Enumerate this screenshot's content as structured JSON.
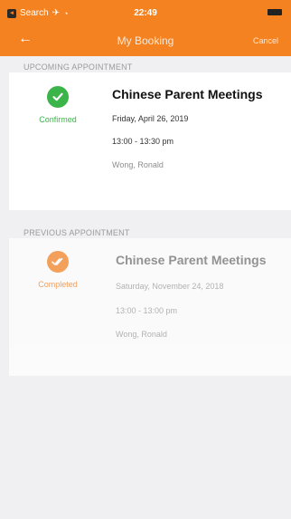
{
  "status_bar": {
    "carrier": "Search",
    "time": "22:49"
  },
  "nav": {
    "back_icon": "back-arrow-icon",
    "title": "My Booking",
    "cancel_label": "Cancel"
  },
  "upcoming": {
    "section_label": "UPCOMING APPOINTMENT",
    "status_label": "Confirmed",
    "status_color": "#3bb44a",
    "meeting_title": "Chinese Parent Meetings",
    "date": "Friday, April 26, 2019",
    "time": "13:00 - 13:30 pm",
    "person": "Wong, Ronald"
  },
  "previous": {
    "section_label": "PREVIOUS APPOINTMENT",
    "status_label": "Completed",
    "status_color": "#f58220",
    "meeting_title": "Chinese Parent Meetings",
    "date": "Saturday, November 24, 2018",
    "time": "13:00 - 13:00 pm",
    "person": "Wong, Ronald"
  },
  "colors": {
    "brand": "#f58220",
    "confirmed": "#3bb44a"
  }
}
